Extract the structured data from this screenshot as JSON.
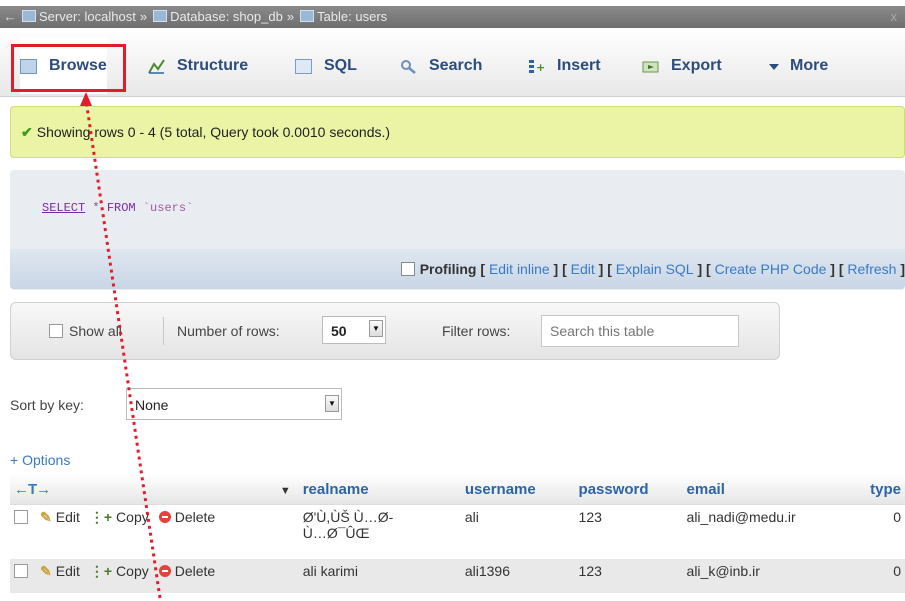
{
  "breadcrumb": {
    "back": "←",
    "server": "Server: localhost",
    "database": "Database: shop_db",
    "table": "Table: users",
    "separator": "»",
    "close": "x"
  },
  "tabs": [
    {
      "label": "Browse",
      "icon": "browse-icon",
      "active": true
    },
    {
      "label": "Structure",
      "icon": "structure-icon"
    },
    {
      "label": "SQL",
      "icon": "sql-icon"
    },
    {
      "label": "Search",
      "icon": "search-icon"
    },
    {
      "label": "Insert",
      "icon": "insert-icon"
    },
    {
      "label": "Export",
      "icon": "export-icon"
    },
    {
      "label": "More",
      "icon": "chevron-down-icon"
    }
  ],
  "message": "Showing rows 0 - 4 (5 total, Query took 0.0010 seconds.)",
  "sql": {
    "select": "SELECT",
    "star": "*",
    "from": "FROM",
    "table": "`users`"
  },
  "sql_links": {
    "profiling": "Profiling",
    "edit_inline": "Edit inline",
    "edit": "Edit",
    "explain": "Explain SQL",
    "create_php": "Create PHP Code",
    "refresh": "Refresh"
  },
  "nav": {
    "show_all": "Show all",
    "number_of_rows_label": "Number of rows:",
    "number_of_rows_value": "50",
    "filter_label": "Filter rows:",
    "filter_placeholder": "Search this table"
  },
  "sort": {
    "label": "Sort by key:",
    "value": "None"
  },
  "options_link": "+ Options",
  "table": {
    "columns": [
      "realname",
      "username",
      "password",
      "email",
      "type"
    ],
    "actions": {
      "edit": "Edit",
      "copy": "Copy",
      "delete": "Delete"
    },
    "rows": [
      {
        "realname": "Ø¹Ù„ÛŒ Ù…Ø­Ù…Ø¯ÛŒ",
        "realname_line1": "Ø'Ù,ÙŠ Ù…Ø-",
        "realname_line2": "Ù…Ø¯ÛŒ",
        "username": "ali",
        "password": "123",
        "email": "ali_nadi@medu.ir",
        "type": "0"
      },
      {
        "realname": "ali karimi",
        "username": "ali1396",
        "password": "123",
        "email": "ali_k@inb.ir",
        "type": "0"
      }
    ]
  },
  "colors": {
    "highlight": "#e01e2b",
    "link": "#3a79c4",
    "success_bg": "#ebf4a5"
  }
}
